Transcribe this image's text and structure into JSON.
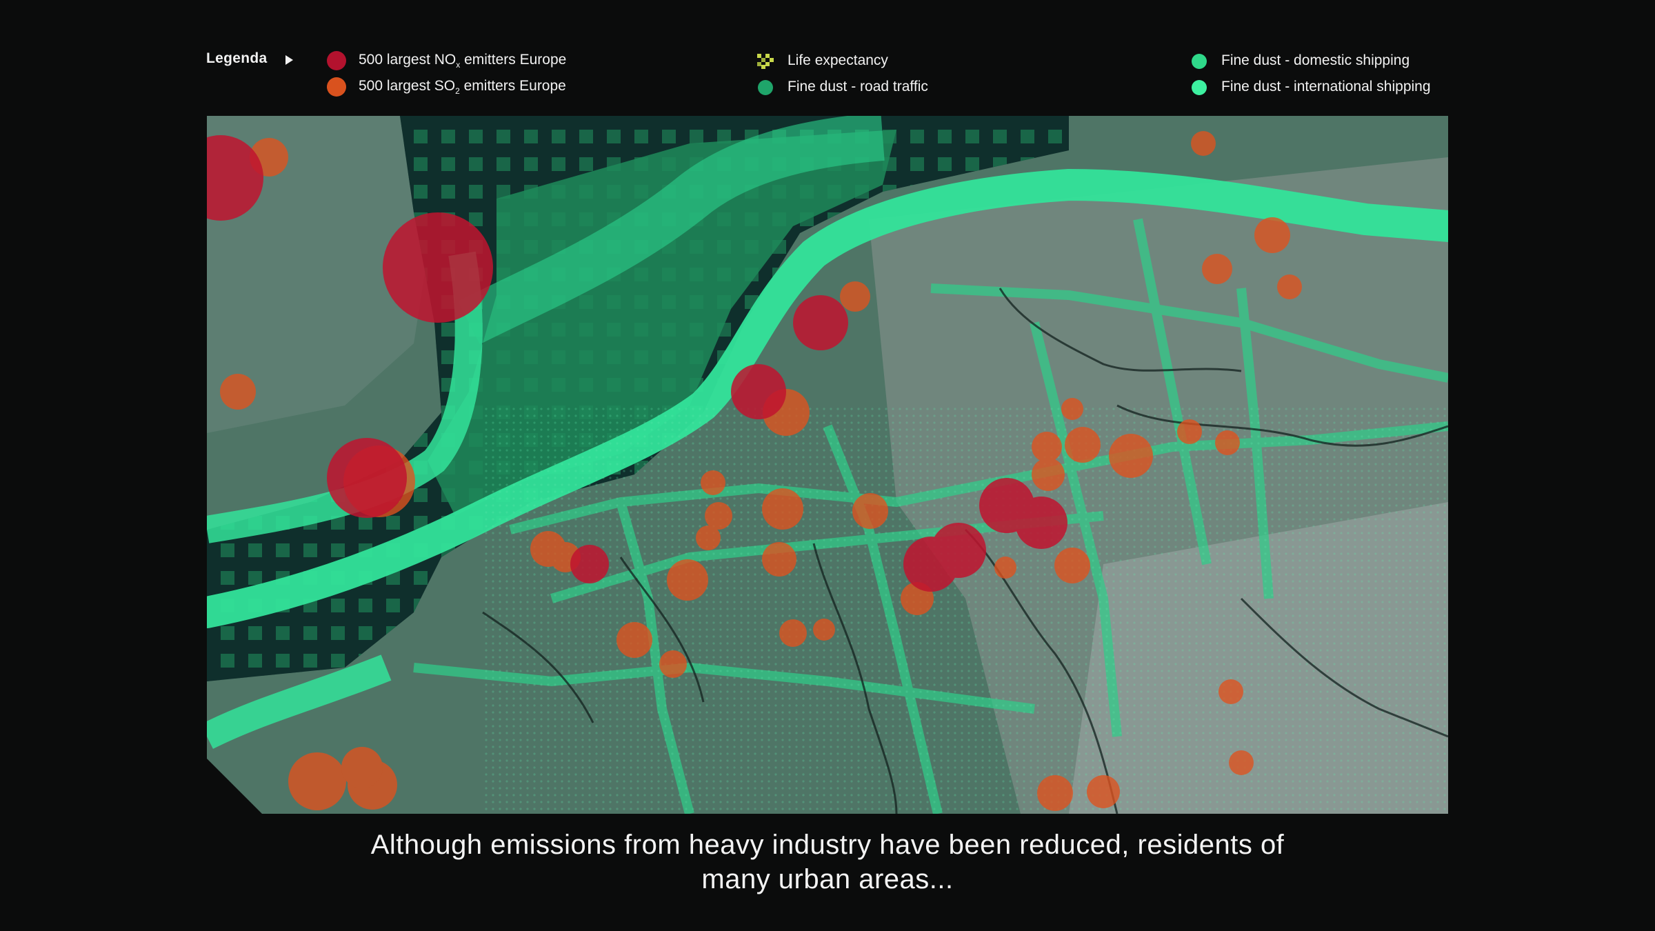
{
  "legend": {
    "title": "Legenda",
    "items": [
      {
        "id": "nox",
        "prefix": "500 largest NO",
        "sub": "x",
        "suffix": " emitters Europe",
        "color": "#b3122e"
      },
      {
        "id": "so2",
        "prefix": "500 largest SO",
        "sub": "2",
        "suffix": " emitters Europe",
        "color": "#d9521e"
      },
      {
        "id": "life",
        "label": "Life expectancy",
        "icon": "checker-icon",
        "color": "#c8d84a"
      },
      {
        "id": "road",
        "label": "Fine dust - road traffic",
        "color": "#1fa56a"
      },
      {
        "id": "domestic",
        "label": "Fine dust - domestic shipping",
        "color": "#2fd98a"
      },
      {
        "id": "international",
        "label": "Fine dust - international shipping",
        "color": "#3df0a0"
      }
    ]
  },
  "map": {
    "colors": {
      "land": "#4f7566",
      "land_light": "#8a9a94",
      "sea_dark": "#0f2f2c",
      "sea_mid": "#1f8a5a",
      "shipping": "#33e39a",
      "nox": "#c0142f",
      "so2": "#e0521e"
    }
  },
  "subtitle": {
    "line1": "Although emissions from heavy industry have been reduced, residents of",
    "line2": "many urban areas..."
  }
}
